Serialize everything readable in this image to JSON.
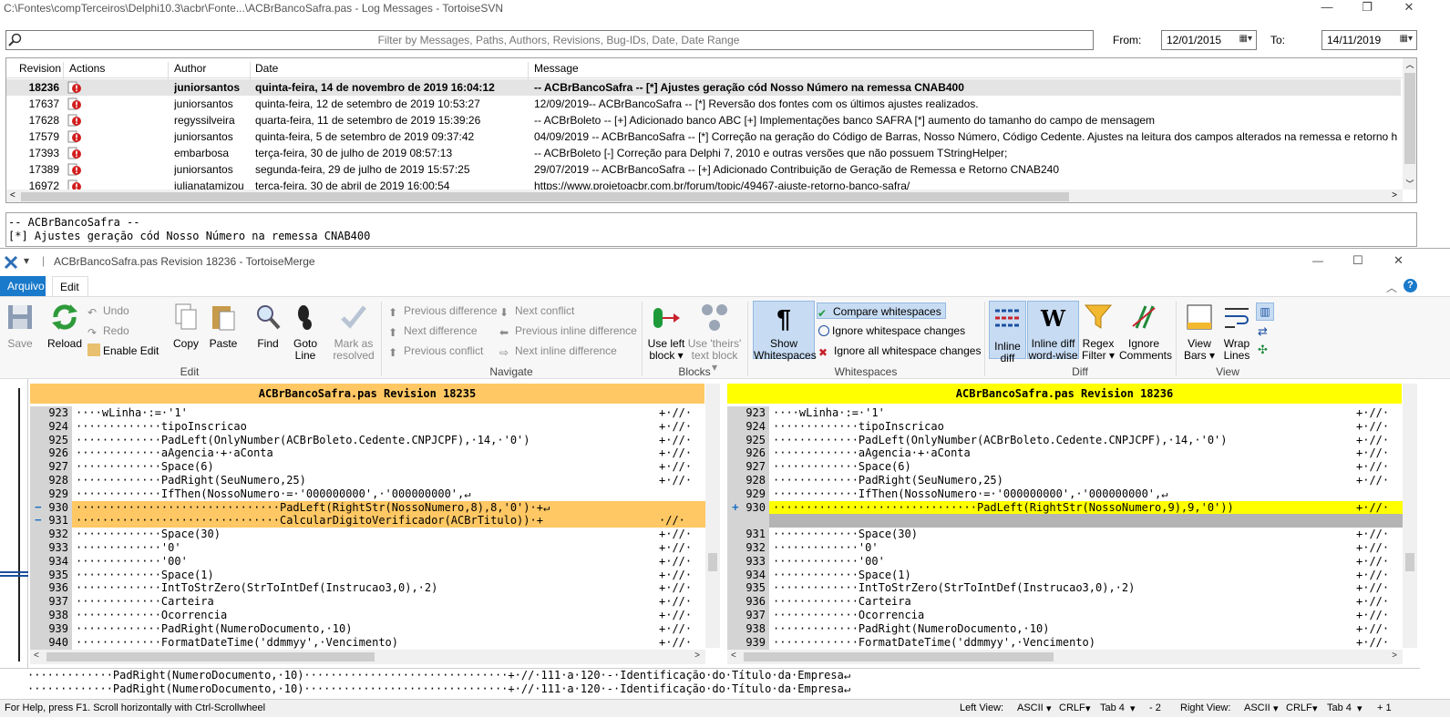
{
  "svn": {
    "title": "C:\\Fontes\\compTerceiros\\Delphi10.3\\acbr\\Fonte...\\ACBrBancoSafra.pas - Log Messages - TortoiseSVN",
    "filter_placeholder": "Filter by Messages, Paths, Authors, Revisions, Bug-IDs, Date, Date Range",
    "from_label": "From:",
    "from_date": "12/01/2015",
    "to_label": "To:",
    "to_date": "14/11/2019",
    "columns": [
      "Revision",
      "Actions",
      "Author",
      "Date",
      "Message"
    ],
    "rows": [
      {
        "rev": "18236",
        "author": "juniorsantos",
        "date": "quinta-feira, 14 de novembro de 2019 16:04:12",
        "msg": "-- ACBrBancoSafra -- [*] Ajustes geração cód Nosso Número na remessa CNAB400"
      },
      {
        "rev": "17637",
        "author": "juniorsantos",
        "date": "quinta-feira, 12 de setembro de 2019 10:53:27",
        "msg": "12/09/2019-- ACBrBancoSafra -- [*] Reversão dos fontes com os últimos ajustes realizados."
      },
      {
        "rev": "17628",
        "author": "regyssilveira",
        "date": "quarta-feira, 11 de setembro de 2019 15:39:26",
        "msg": "-- ACBrBoleto -- [+] Adicionado banco ABC [+] Implementações banco SAFRA [*] aumento do tamanho do campo de mensagem"
      },
      {
        "rev": "17579",
        "author": "juniorsantos",
        "date": "quinta-feira, 5 de setembro de 2019 09:37:42",
        "msg": "04/09/2019 -- ACBrBancoSafra -- [*] Correção na geração do Código de Barras, Nosso Número, Código Cedente. Ajustes na leitura dos campos alterados na remessa e retorno h"
      },
      {
        "rev": "17393",
        "author": "embarbosa",
        "date": "terça-feira, 30 de julho de 2019 08:57:13",
        "msg": "-- ACBrBoleto [-] Correção para Delphi 7, 2010 e outras versões que não possuem TStringHelper;"
      },
      {
        "rev": "17389",
        "author": "juniorsantos",
        "date": "segunda-feira, 29 de julho de 2019 15:57:25",
        "msg": "29/07/2019 -- ACBrBancoSafra -- [+] Adicionado Contribuição de Geração de Remessa e Retorno CNAB240"
      },
      {
        "rev": "16972",
        "author": "julianatamizou",
        "date": "terça-feira, 30 de abril de 2019 16:00:54",
        "msg": "https://www.projetoacbr.com.br/forum/topic/49467-ajuste-retorno-banco-safra/"
      }
    ],
    "message_text": "-- ACBrBancoSafra --\n[*] Ajustes geração cód Nosso Número na remessa CNAB400"
  },
  "merge": {
    "title": "ACBrBancoSafra.pas Revision 18236 - TortoiseMerge",
    "tabs": [
      "Arquivo",
      "Edit"
    ],
    "buttons": {
      "save": "Save",
      "reload": "Reload",
      "undo": "Undo",
      "redo": "Redo",
      "enable_edit": "Enable Edit",
      "copy": "Copy",
      "paste": "Paste",
      "find": "Find",
      "goto1": "Goto",
      "goto2": "Line",
      "mark1": "Mark as",
      "mark2": "resolved",
      "prev_diff": "Previous difference",
      "next_diff": "Next difference",
      "prev_conflict": "Previous conflict",
      "next_conflict": "Next conflict",
      "prev_inline": "Previous inline difference",
      "next_inline": "Next inline difference",
      "use_left1": "Use left",
      "use_left2": "block",
      "use_theirs1": "Use 'theirs'",
      "use_theirs2": "text block",
      "show_ws1": "Show",
      "show_ws2": "Whitespaces",
      "compare_ws": "Compare whitespaces",
      "ignore_ws_changes": "Ignore whitespace changes",
      "ignore_all_ws": "Ignore all whitespace changes",
      "inline1": "Inline",
      "inline2": "diff",
      "inlinew1": "Inline diff",
      "inlinew2": "word-wise",
      "regex1": "Regex",
      "regex2": "Filter",
      "ignc1": "Ignore",
      "ignc2": "Comments",
      "viewbars1": "View",
      "viewbars2": "Bars",
      "wrap1": "Wrap",
      "wrap2": "Lines"
    },
    "groups": [
      "Edit",
      "Navigate",
      "Blocks",
      "Whitespaces",
      "Diff",
      "View"
    ],
    "left_title": "ACBrBancoSafra.pas Revision 18235",
    "right_title": "ACBrBancoSafra.pas Revision 18236",
    "left_lines": [
      {
        "no": "923",
        "text": "····wLinha·:=·'1'",
        "right": "+·//·"
      },
      {
        "no": "924",
        "text": "·············tipoInscricao",
        "right": "+·//·"
      },
      {
        "no": "925",
        "text": "·············PadLeft(OnlyNumber(ACBrBoleto.Cedente.CNPJCPF),·14,·'0')",
        "right": "+·//·"
      },
      {
        "no": "926",
        "text": "·············aAgencia·+·aConta",
        "right": "+·//·"
      },
      {
        "no": "927",
        "text": "·············Space(6)",
        "right": "+·//·"
      },
      {
        "no": "928",
        "text": "·············PadRight(SeuNumero,25)",
        "right": "+·//·"
      },
      {
        "no": "929",
        "text": "·············IfThen(NossoNumero·=·'000000000',·'000000000',↵",
        "right": ""
      },
      {
        "no": "930",
        "text": "·······························PadLeft(RightStr(NossoNumero,8),8,'0')·+↵",
        "right": ""
      },
      {
        "no": "931",
        "text": "·······························CalcularDigitoVerificador(ACBrTitulo))·+",
        "right": "·//·"
      },
      {
        "no": "932",
        "text": "·············Space(30)",
        "right": "+·//·"
      },
      {
        "no": "933",
        "text": "·············'0'",
        "right": "+·//·"
      },
      {
        "no": "934",
        "text": "·············'00'",
        "right": "+·//·"
      },
      {
        "no": "935",
        "text": "·············Space(1)",
        "right": "+·//·"
      },
      {
        "no": "936",
        "text": "·············IntToStrZero(StrToIntDef(Instrucao3,0),·2)",
        "right": "+·//·"
      },
      {
        "no": "937",
        "text": "·············Carteira",
        "right": "+·//·"
      },
      {
        "no": "938",
        "text": "·············Ocorrencia",
        "right": "+·//·"
      },
      {
        "no": "939",
        "text": "·············PadRight(NumeroDocumento,·10)",
        "right": "+·//·"
      },
      {
        "no": "940",
        "text": "·············FormatDateTime('ddmmyy',·Vencimento)",
        "right": "+·//·"
      }
    ],
    "right_lines": [
      {
        "no": "923",
        "text": "····wLinha·:=·'1'",
        "right": "+·//·"
      },
      {
        "no": "924",
        "text": "·············tipoInscricao",
        "right": "+·//·"
      },
      {
        "no": "925",
        "text": "·············PadLeft(OnlyNumber(ACBrBoleto.Cedente.CNPJCPF),·14,·'0')",
        "right": "+·//·"
      },
      {
        "no": "926",
        "text": "·············aAgencia·+·aConta",
        "right": "+·//·"
      },
      {
        "no": "927",
        "text": "·············Space(6)",
        "right": "+·//·"
      },
      {
        "no": "928",
        "text": "·············PadRight(SeuNumero,25)",
        "right": "+·//·"
      },
      {
        "no": "929",
        "text": "·············IfThen(NossoNumero·=·'000000000',·'000000000',↵",
        "right": ""
      },
      {
        "no": "930",
        "text": "·······························PadLeft(RightStr(NossoNumero,9),9,'0'))",
        "right": "+·//·"
      },
      {
        "no": "",
        "text": "",
        "right": ""
      },
      {
        "no": "931",
        "text": "·············Space(30)",
        "right": "+·//·"
      },
      {
        "no": "932",
        "text": "·············'0'",
        "right": "+·//·"
      },
      {
        "no": "933",
        "text": "·············'00'",
        "right": "+·//·"
      },
      {
        "no": "934",
        "text": "·············Space(1)",
        "right": "+·//·"
      },
      {
        "no": "935",
        "text": "·············IntToStrZero(StrToIntDef(Instrucao3,0),·2)",
        "right": "+·//·"
      },
      {
        "no": "936",
        "text": "·············Carteira",
        "right": "+·//·"
      },
      {
        "no": "937",
        "text": "·············Ocorrencia",
        "right": "+·//·"
      },
      {
        "no": "938",
        "text": "·············PadRight(NumeroDocumento,·10)",
        "right": "+·//·"
      },
      {
        "no": "939",
        "text": "·············FormatDateTime('ddmmyy',·Vencimento)",
        "right": "+·//·"
      }
    ],
    "bottom_lines": [
      "·············PadRight(NumeroDocumento,·10)·······························+·//·111·a·120·-·Identificação·do·Título·da·Empresa↵",
      "·············PadRight(NumeroDocumento,·10)·······························+·//·111·a·120·-·Identificação·do·Título·da·Empresa↵"
    ],
    "status_help": "For Help, press F1. Scroll horizontally with Ctrl-Scrollwheel",
    "status_left": "Left View:",
    "status_right": "Right View:",
    "enc_left": "ASCII",
    "eol_left": "CRLF",
    "tab_left": "Tab 4",
    "diff_left": "- 2",
    "enc_right": "ASCII",
    "eol_right": "CRLF",
    "tab_right": "Tab 4",
    "diff_right": "+ 1"
  },
  "colors": {
    "left_head": "#ffc864",
    "right_head": "#ffff00",
    "removed": "#ffc864",
    "added": "#ffff00",
    "accent": "#1979ca"
  }
}
